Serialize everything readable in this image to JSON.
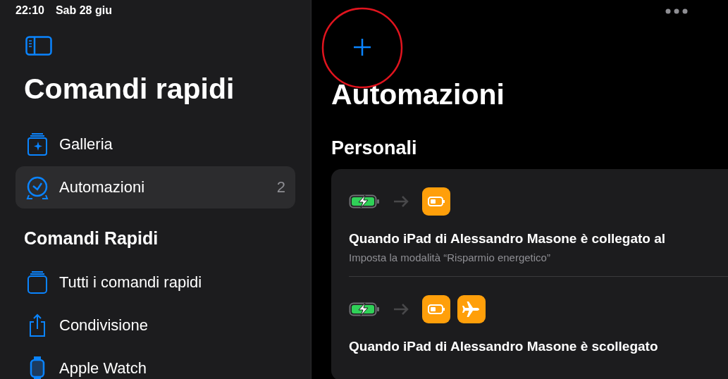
{
  "status_bar": {
    "time": "22:10",
    "date": "Sab 28 giu"
  },
  "sidebar": {
    "title": "Comandi rapidi",
    "items": [
      {
        "label": "Galleria",
        "kind": "gallery",
        "selected": false
      },
      {
        "label": "Automazioni",
        "kind": "clock",
        "count": "2",
        "selected": true
      }
    ],
    "section": "Comandi Rapidi",
    "section_items": [
      {
        "label": "Tutti i comandi rapidi",
        "kind": "stack",
        "selected": false
      },
      {
        "label": "Condivisione",
        "kind": "share",
        "selected": false
      },
      {
        "label": "Apple Watch",
        "kind": "watch",
        "selected": false
      }
    ]
  },
  "main": {
    "title": "Automazioni",
    "section": "Personali",
    "automations": [
      {
        "trigger": {
          "kind": "charging"
        },
        "actions": [
          {
            "kind": "low-power"
          }
        ],
        "title": "Quando iPad di Alessandro Masone è collegato al",
        "subtitle": "Imposta la modalità “Risparmio energetico”"
      },
      {
        "trigger": {
          "kind": "charging"
        },
        "actions": [
          {
            "kind": "low-power"
          },
          {
            "kind": "airplane"
          }
        ],
        "title": "Quando iPad di Alessandro Masone è scollegato"
      }
    ]
  }
}
